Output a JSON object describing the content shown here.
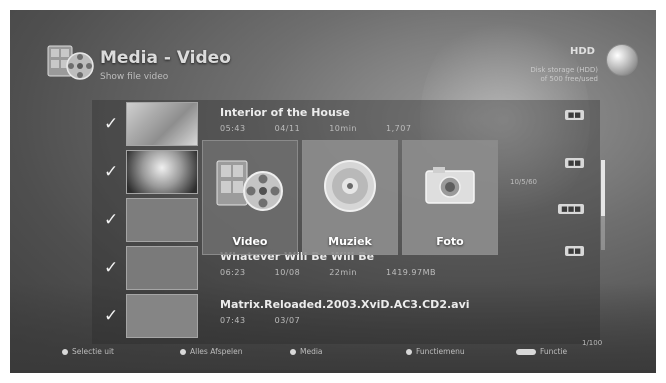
{
  "header": {
    "title": "Media - Video",
    "subtitle": "Show file video",
    "icon": "film-reel-icon"
  },
  "storage": {
    "label": "HDD",
    "icon": "disc-icon",
    "info_line1": "Disk storage (HDD)",
    "info_line2": "of 500 free/used"
  },
  "list": {
    "items": [
      {
        "checked": "✓",
        "title": "Interior of the House",
        "meta": [
          "05:43",
          "04/11",
          "10min",
          "1,707"
        ],
        "badge": "■■"
      },
      {
        "checked": "✓",
        "title": "",
        "meta": [],
        "badge": "■■"
      },
      {
        "checked": "✓",
        "title": "",
        "meta": [],
        "badge": "■■■"
      },
      {
        "checked": "✓",
        "title": "Whatever Will Be Will Be",
        "meta": [
          "06:23",
          "10/08",
          "22min",
          "1419.97MB"
        ],
        "badge": "■■"
      },
      {
        "checked": "✓",
        "title": "Matrix.Reloaded.2003.XviD.AC3.CD2.avi",
        "meta": [
          "07:43",
          "03/07"
        ],
        "badge": ""
      }
    ],
    "side_text": "10/5/60"
  },
  "popup_menu": {
    "items": [
      {
        "label": "Video",
        "icon": "video-film-icon"
      },
      {
        "label": "Muziek",
        "icon": "music-cd-icon"
      },
      {
        "label": "Foto",
        "icon": "photo-camera-icon"
      }
    ]
  },
  "footer": {
    "items": [
      {
        "label": "Selectie uit",
        "key": "dot"
      },
      {
        "label": "Alles Afspelen",
        "key": "dot"
      },
      {
        "label": "Media",
        "key": "dot"
      },
      {
        "label": "Functiemenu",
        "key": "dot"
      },
      {
        "label": "Functie",
        "key": "pill"
      }
    ],
    "page": "1/100"
  }
}
